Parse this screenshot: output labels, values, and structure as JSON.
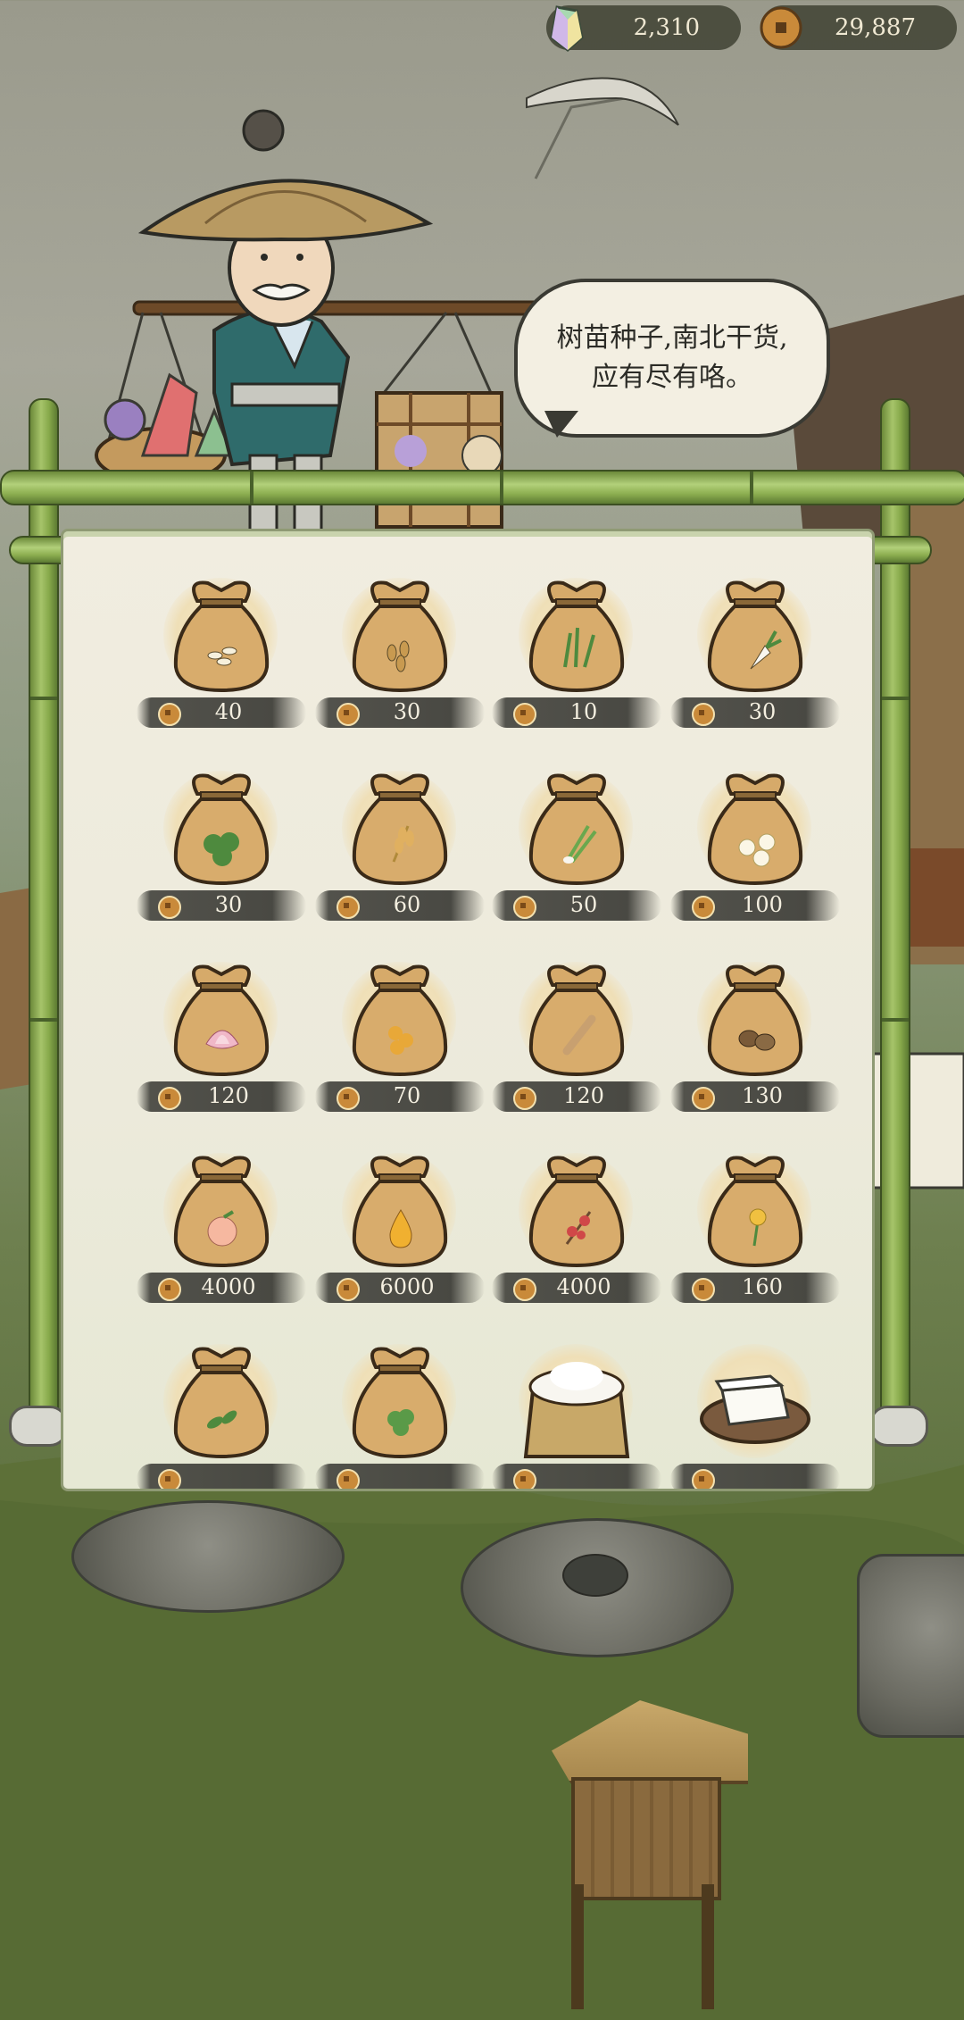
{
  "currency": {
    "jade": {
      "value": "2,310",
      "icon": "jade-crystal-icon"
    },
    "coin": {
      "value": "29,887",
      "icon": "copper-coin-icon"
    }
  },
  "merchant": {
    "speech_line1": "树苗种子,南北干货,",
    "speech_line2": "应有尽有咯。"
  },
  "shop": {
    "items": [
      {
        "icon": "seed-bag-grain-icon",
        "price": "40"
      },
      {
        "icon": "seed-bag-seeds-icon",
        "price": "30"
      },
      {
        "icon": "seed-bag-grass-icon",
        "price": "10"
      },
      {
        "icon": "seed-bag-radish-icon",
        "price": "30"
      },
      {
        "icon": "seed-bag-clover-icon",
        "price": "30"
      },
      {
        "icon": "seed-bag-wheat-icon",
        "price": "60"
      },
      {
        "icon": "seed-bag-scallion-icon",
        "price": "50"
      },
      {
        "icon": "seed-bag-jasmine-icon",
        "price": "100"
      },
      {
        "icon": "seed-bag-lotus-icon",
        "price": "120"
      },
      {
        "icon": "seed-bag-beans-icon",
        "price": "70"
      },
      {
        "icon": "seed-bag-root-icon",
        "price": "120"
      },
      {
        "icon": "seed-bag-nuts-icon",
        "price": "130"
      },
      {
        "icon": "seed-bag-peach-icon",
        "price": "4000"
      },
      {
        "icon": "seed-bag-pear-icon",
        "price": "6000"
      },
      {
        "icon": "seed-bag-plum-blossom-icon",
        "price": "4000"
      },
      {
        "icon": "seed-bag-flower-icon",
        "price": "160"
      },
      {
        "icon": "seed-bag-tea-icon",
        "price": ""
      },
      {
        "icon": "seed-bag-herb-icon",
        "price": ""
      },
      {
        "icon": "flour-sack-icon",
        "price": ""
      },
      {
        "icon": "tofu-plate-icon",
        "price": ""
      }
    ]
  },
  "colors": {
    "bamboo": "#8cae50",
    "panel": "#eeebdc",
    "bag": "#d6aa6a",
    "price_strip": "#37372f"
  }
}
